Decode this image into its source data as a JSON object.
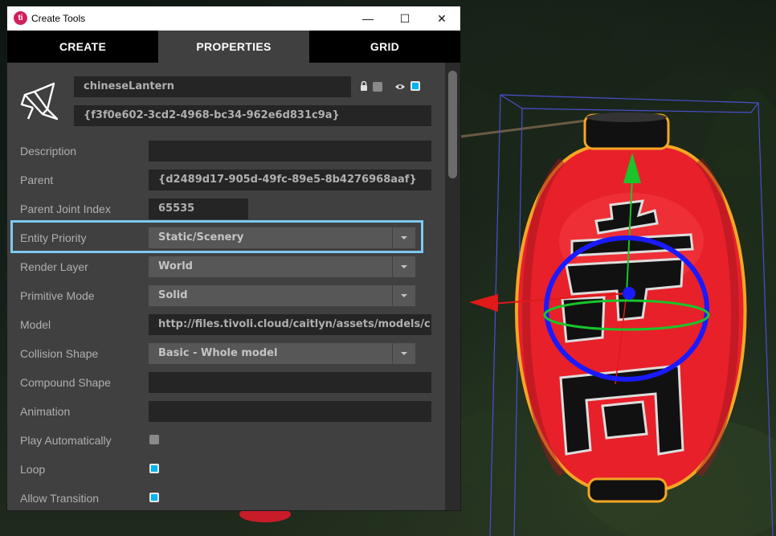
{
  "window": {
    "app_icon_text": "ti",
    "title": "Create Tools",
    "controls": {
      "minimize": "—",
      "maximize": "☐",
      "close": "✕"
    }
  },
  "tabs": [
    {
      "label": "CREATE",
      "active": false
    },
    {
      "label": "PROPERTIES",
      "active": true
    },
    {
      "label": "GRID",
      "active": false
    }
  ],
  "entity": {
    "icon": "origami-bird-icon",
    "name": "chineseLantern",
    "id": "{f3f0e602-3cd2-4968-bc34-962e6d831c9a}",
    "locked": false,
    "visible": true
  },
  "properties": {
    "description": {
      "label": "Description",
      "value": ""
    },
    "parent": {
      "label": "Parent",
      "value": "{d2489d17-905d-49fc-89e5-8b4276968aaf}"
    },
    "parent_joint_index": {
      "label": "Parent Joint Index",
      "value": "65535"
    },
    "entity_priority": {
      "label": "Entity Priority",
      "value": "Static/Scenery",
      "highlighted": true
    },
    "render_layer": {
      "label": "Render Layer",
      "value": "World"
    },
    "primitive_mode": {
      "label": "Primitive Mode",
      "value": "Solid"
    },
    "model": {
      "label": "Model",
      "value": "http://files.tivoli.cloud/caitlyn/assets/models/c"
    },
    "collision_shape": {
      "label": "Collision Shape",
      "value": "Basic - Whole model"
    },
    "compound_shape": {
      "label": "Compound Shape",
      "value": ""
    },
    "animation": {
      "label": "Animation",
      "value": ""
    },
    "play_automatically": {
      "label": "Play Automatically",
      "checked": false
    },
    "loop": {
      "label": "Loop",
      "checked": true
    },
    "allow_transition": {
      "label": "Allow Transition",
      "checked": true
    }
  },
  "colors": {
    "accent": "#00b4ef",
    "highlight": "#7ec9f2",
    "panel": "#404040",
    "lantern_red": "#e8202a",
    "selection_orange": "#f5a623"
  }
}
